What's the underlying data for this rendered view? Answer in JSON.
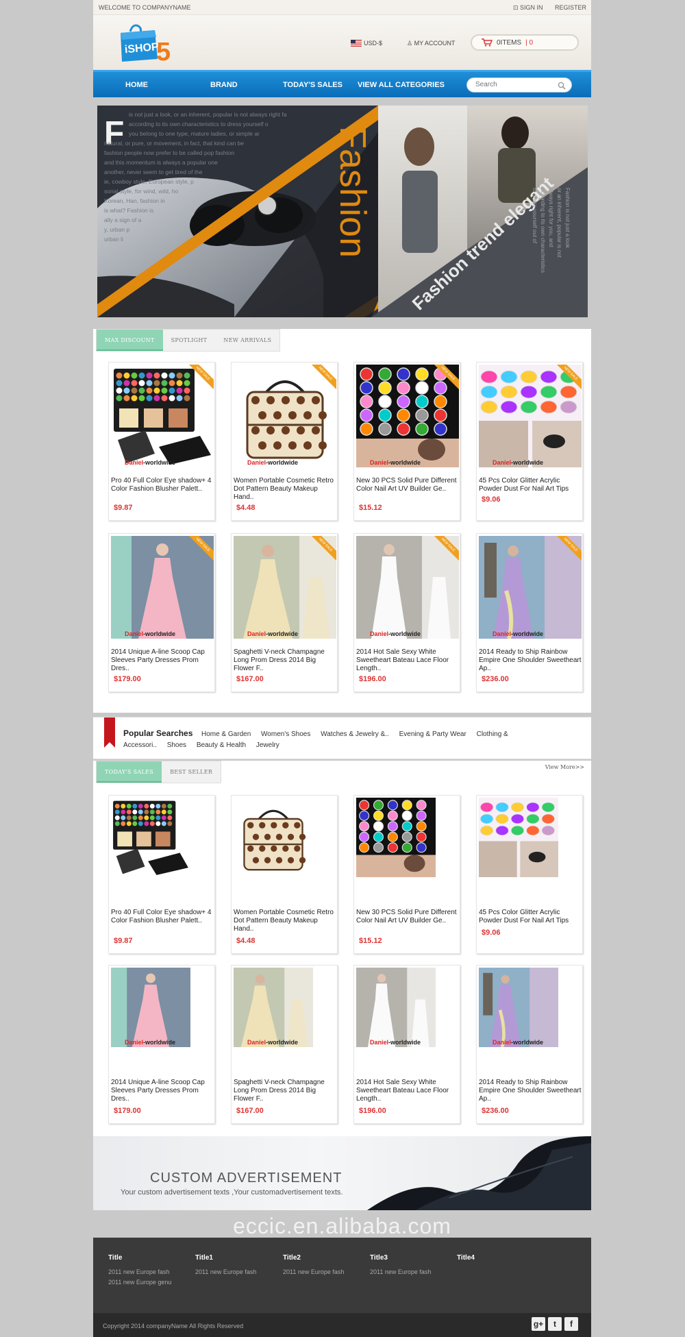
{
  "topbar": {
    "welcome": "WELCOME TO COMPANYNAME",
    "signin": "SIGN IN",
    "register": "REGISTER"
  },
  "header": {
    "logo_text": "iSHOP",
    "logo_number": "5",
    "currency": "USD-$",
    "account": "MY ACCOUNT",
    "cart_items": "0ITEMS",
    "cart_amount": "| 0"
  },
  "nav": {
    "items": [
      "HOME",
      "BRAND",
      "TODAY'S SALES",
      "VIEW ALL CATEGORIES"
    ],
    "search_placeholder": "Search"
  },
  "banner": {
    "word": "Fashion",
    "tagline": "Fashion trend elegant",
    "big_letter": "F",
    "left_text": [
      "is not just a look, or an inherent, popular is not always right fa",
      "according to its own characteristics to dress yourself o",
      "you belong to one type, mature ladies, or simple ar",
      "natural, or pure, or movement, in fact, that kind can be",
      "fashion people now prefer to be called pop fashion",
      "and this momentum is always a popular one",
      "another, never seem to get tired of the",
      "ie, cowboy style, European style, p",
      "sonal style, for wind, wild, ho",
      "Korean, Han, fashion in",
      "is what? Fashion is",
      "ally a sign of a",
      "y, urban p",
      "urban li"
    ],
    "right_text": [
      "Fashion is not just a look",
      "or an inherent, popular is not",
      "always right for you, and",
      "according to its own characteristics",
      "to dress yourself out of"
    ]
  },
  "section1": {
    "tabs": [
      "MAX DISCOUNT",
      "SPOTLIGHT",
      "NEW ARRIVALS"
    ],
    "ribbon": "NEW SALE",
    "brand_mark": "Daniel",
    "brand_suffix": "-worldwide"
  },
  "products": [
    {
      "title": "Pro 40 Full Color Eye shadow+ 4 Color Fashion Blusher Palett..",
      "price": "$9.87"
    },
    {
      "title": "Women Portable Cosmetic Retro Dot Pattern Beauty Makeup Hand..",
      "price": "$4.48"
    },
    {
      "title": "New 30 PCS Solid Pure Different Color Nail Art UV Builder Ge..",
      "price": "$15.12"
    },
    {
      "title": "45 Pcs Color Glitter Acrylic Powder Dust For Nail Art Tips",
      "price": "$9.06"
    },
    {
      "title": "2014 Unique A-line Scoop Cap Sleeves Party Dresses Prom Dres..",
      "price": "$179.00"
    },
    {
      "title": "Spaghetti V-neck Champagne Long Prom Dress 2014 Big Flower F..",
      "price": "$167.00"
    },
    {
      "title": "2014 Hot Sale Sexy White Sweetheart Bateau Lace Floor Length..",
      "price": "$196.00"
    },
    {
      "title": "2014 Ready to Ship Rainbow Empire One Shoulder Sweetheart Ap..",
      "price": "$236.00"
    }
  ],
  "popular": {
    "label": "Popular Searches",
    "tags": [
      "Home & Garden",
      "Women's Shoes",
      "Watches & Jewelry &..",
      "Evening & Party Wear",
      "Clothing & Accessori..",
      "Shoes",
      "Beauty & Health",
      "Jewelry"
    ]
  },
  "section2": {
    "tabs": [
      "TODAY'S SALES",
      "BEST SELLER"
    ],
    "view_more": "View More>>"
  },
  "ad": {
    "headline": "CUSTOM  ADVERTISEMENT",
    "sub": "Your custom advertisement texts ,Your customadvertisement texts."
  },
  "watermark": "eccic.en.alibaba.com",
  "footer": {
    "columns": [
      {
        "title": "Title",
        "links": [
          "2011 new Europe fash",
          "2011 new Europe genu"
        ]
      },
      {
        "title": "Title1",
        "links": [
          "2011 new Europe fash"
        ]
      },
      {
        "title": "Title2",
        "links": [
          "2011 new Europe fash"
        ]
      },
      {
        "title": "Title3",
        "links": [
          "2011 new Europe fash"
        ]
      },
      {
        "title": "Title4",
        "links": []
      }
    ],
    "copyright": "Copyright 2014 companyName All Rights Reserved",
    "social": [
      "g+",
      "t",
      "f"
    ]
  },
  "colors": {
    "accent_blue": "#0a6cb8",
    "price_red": "#d33333",
    "tab_green": "#8fd4b4",
    "ribbon_orange": "#f0a020"
  }
}
